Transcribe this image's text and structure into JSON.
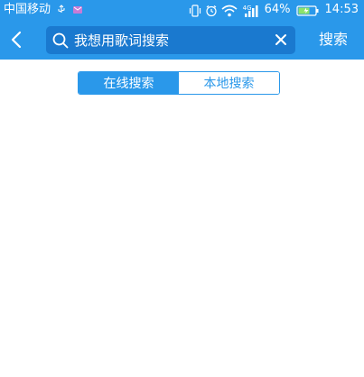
{
  "status_bar": {
    "carrier": "中国移动",
    "network": "4G",
    "battery": "64%",
    "time": "14:53",
    "icons": [
      "usb-icon",
      "message-icon",
      "vibrate-icon",
      "alarm-icon",
      "wifi-icon",
      "signal-icon",
      "battery-icon"
    ]
  },
  "toolbar": {
    "search_placeholder": "我想用歌词搜索",
    "search_button": "搜索",
    "icons": [
      "back-arrow-icon",
      "search-icon",
      "clear-icon"
    ]
  },
  "tabs": {
    "items": [
      {
        "label": "在线搜索",
        "active": true
      },
      {
        "label": "本地搜索",
        "active": false
      }
    ]
  },
  "colors": {
    "primary": "#2a98ea",
    "search_field": "#1a79cf",
    "background": "#ffffff"
  }
}
